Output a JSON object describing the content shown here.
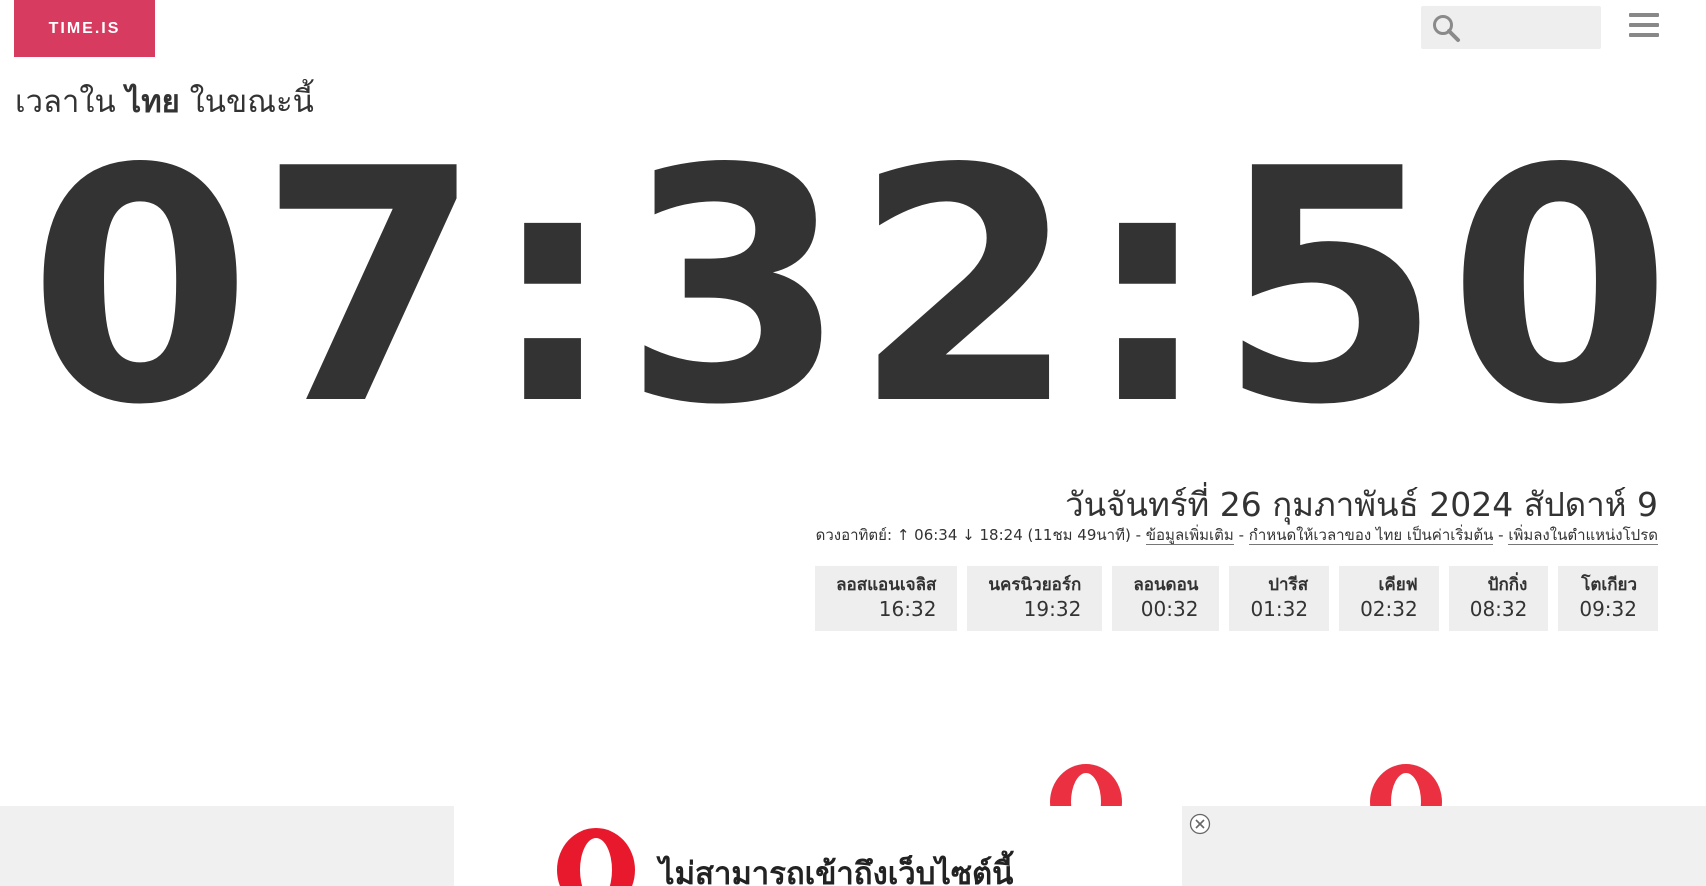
{
  "header": {
    "logo": "TIME.IS",
    "search_placeholder": "",
    "icons": {
      "search": "search-icon",
      "menu": "hamburger-menu-icon"
    }
  },
  "heading": {
    "prefix": "เวลาใน",
    "place": "ไทย",
    "suffix": "ในขณะนี้"
  },
  "clock": {
    "time": "07:32:50"
  },
  "date": {
    "text": "วันจันทร์ที่ 26 กุมภาพันธ์ 2024 สัปดาห์ 9"
  },
  "sun": {
    "label": "ดวงอาทิตย์:",
    "sunrise": "↑ 06:34",
    "sunset": "↓ 18:24",
    "daylength": "(11ชม 49นาที)",
    "link_more": "ข้อมูลเพิ่มเติม",
    "link_default": "กำหนดให้เวลาของ ไทย เป็นค่าเริ่มต้น",
    "link_favorite": "เพิ่มลงในตำแหน่งโปรด",
    "separator": "-"
  },
  "cities": [
    {
      "name": "ลอสแอนเจลิส",
      "time": "16:32"
    },
    {
      "name": "นครนิวยอร์ก",
      "time": "19:32"
    },
    {
      "name": "ลอนดอน",
      "time": "00:32"
    },
    {
      "name": "ปารีส",
      "time": "01:32"
    },
    {
      "name": "เคียฟ",
      "time": "02:32"
    },
    {
      "name": "ปักกิ่ง",
      "time": "08:32"
    },
    {
      "name": "โตเกียว",
      "time": "09:32"
    }
  ],
  "ad": {
    "message": "ไม่สามารถเข้าถึงเว็บไซต์นี้",
    "icons": {
      "logo": "opera-logo-icon",
      "close": "close-icon"
    }
  },
  "colors": {
    "brand": "#d73b5f",
    "text": "#333333",
    "chip_bg": "#eeeeee",
    "opera_red": "#e8192c"
  }
}
